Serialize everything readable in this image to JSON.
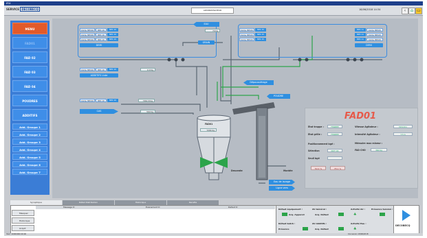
{
  "app": {
    "title": "IFIX",
    "logo_pre": "SERVICE",
    "logo_brand": "DECOBECQ",
    "center_field": "ADMINISTRATEUR",
    "datetime": "18/06/2018  14:34"
  },
  "sidebar": {
    "items": [
      {
        "label": "MENU"
      },
      {
        "label": "FAD01"
      },
      {
        "label": "FAD 02"
      },
      {
        "label": "FAD 03"
      },
      {
        "label": "FAD 04"
      },
      {
        "label": "POUDRES"
      },
      {
        "label": "ADDITIFS"
      }
    ],
    "groups": [
      "Add. Groupe 1",
      "Add. Groupe 2",
      "Add. Groupe 3",
      "Add. Groupe 4",
      "Add. Groupe 5",
      "Add. Groupe 6",
      "Add. Groupe 7"
    ]
  },
  "process": {
    "eau": "EAU",
    "eau_val": "70 Kg",
    "demi_left": "DEMI",
    "demi_right": "DEMI",
    "grain": "GRAIN",
    "comp_rows_left": [
      "Comp. MPC10",
      "Comp. MPC10",
      "Comp. MPC10"
    ],
    "comp_rows_right": [
      "Comp. MPC15",
      "Comp. MPC15",
      "Comp. MPC15"
    ],
    "mpc_l": [
      "MPC 10",
      "MPC 10",
      "MPC 10"
    ],
    "mpc_r": [
      "MPC 15",
      "MPC 15",
      "MPC 15"
    ],
    "mpc_rr": [
      "MPC 11",
      "MPC 11",
      "MPC 11"
    ],
    "additif_label": "ADDITIFS Liste",
    "additif_val": "0.0 Kg",
    "huile_val": "7262.8 Kg",
    "huile_label": "CAS",
    "huile_val2": "560 Kg",
    "depoussierage": "Dépoussiérage",
    "poudre": "POUDRE",
    "tank_label": "FAD01",
    "tank_val": "7294 Kg",
    "descente": "Descente",
    "montee": "Montée",
    "eau_lavage": "Eau de lavage",
    "ligne_vers": "Ligne vers"
  },
  "fad01": {
    "title": "FAD01",
    "etat_trappe": "Etat trappe :",
    "etat_trappe_v": "FERMEE",
    "etat_grille": "Etat grille :",
    "etat_grille_v": "FERMEE",
    "positionnement": "Positionnement bgé :",
    "selection": "Sélection",
    "selection_v": "NOT OK",
    "seuil": "Seuil bgé",
    "pct1": "50.0 %",
    "pct2": "78.1 %",
    "vitesse": "Vitesse Agitateur :",
    "vitesse_v": "30 tr/mn",
    "intensite": "Intensité Agitateur :",
    "intensite_v": "7.5 A",
    "memoire": "Mémoire max mixeur :",
    "memoire_lbl": "FAD CHO",
    "memoire_v": "360 Kg"
  },
  "tabs": [
    "Synoptique",
    "Détail Distribution",
    "Historique",
    "Recette"
  ],
  "alarms": {
    "headers": [
      "Message D",
      "Evenement D",
      "Defaut D"
    ],
    "buttons": [
      "Masquer",
      "Historique",
      "Acquit"
    ]
  },
  "status": {
    "defaut_equipement": "Défaut équipement :",
    "acq_appareil": "Acq. Appareil",
    "arret_general": "AU Général :",
    "arrete": "Acq. Défaut",
    "activite_air": "Activité Air :",
    "presence_tension": "Présence tension :",
    "defaut_batch": "Défaut batch :",
    "presence": "Présence",
    "au_additifs": "AU Additifs :",
    "acq_defaut2": "Acq. Défaut",
    "activite_eau": "Activité Eau :"
  },
  "footer": {
    "left": "User: 20000000 00:00",
    "right": "Connexion 18/06/2018"
  },
  "colors": {
    "accent": "#2f8fe0",
    "active": "#e25a2a",
    "green": "#2ca44a",
    "red_title": "#e65a4a"
  }
}
